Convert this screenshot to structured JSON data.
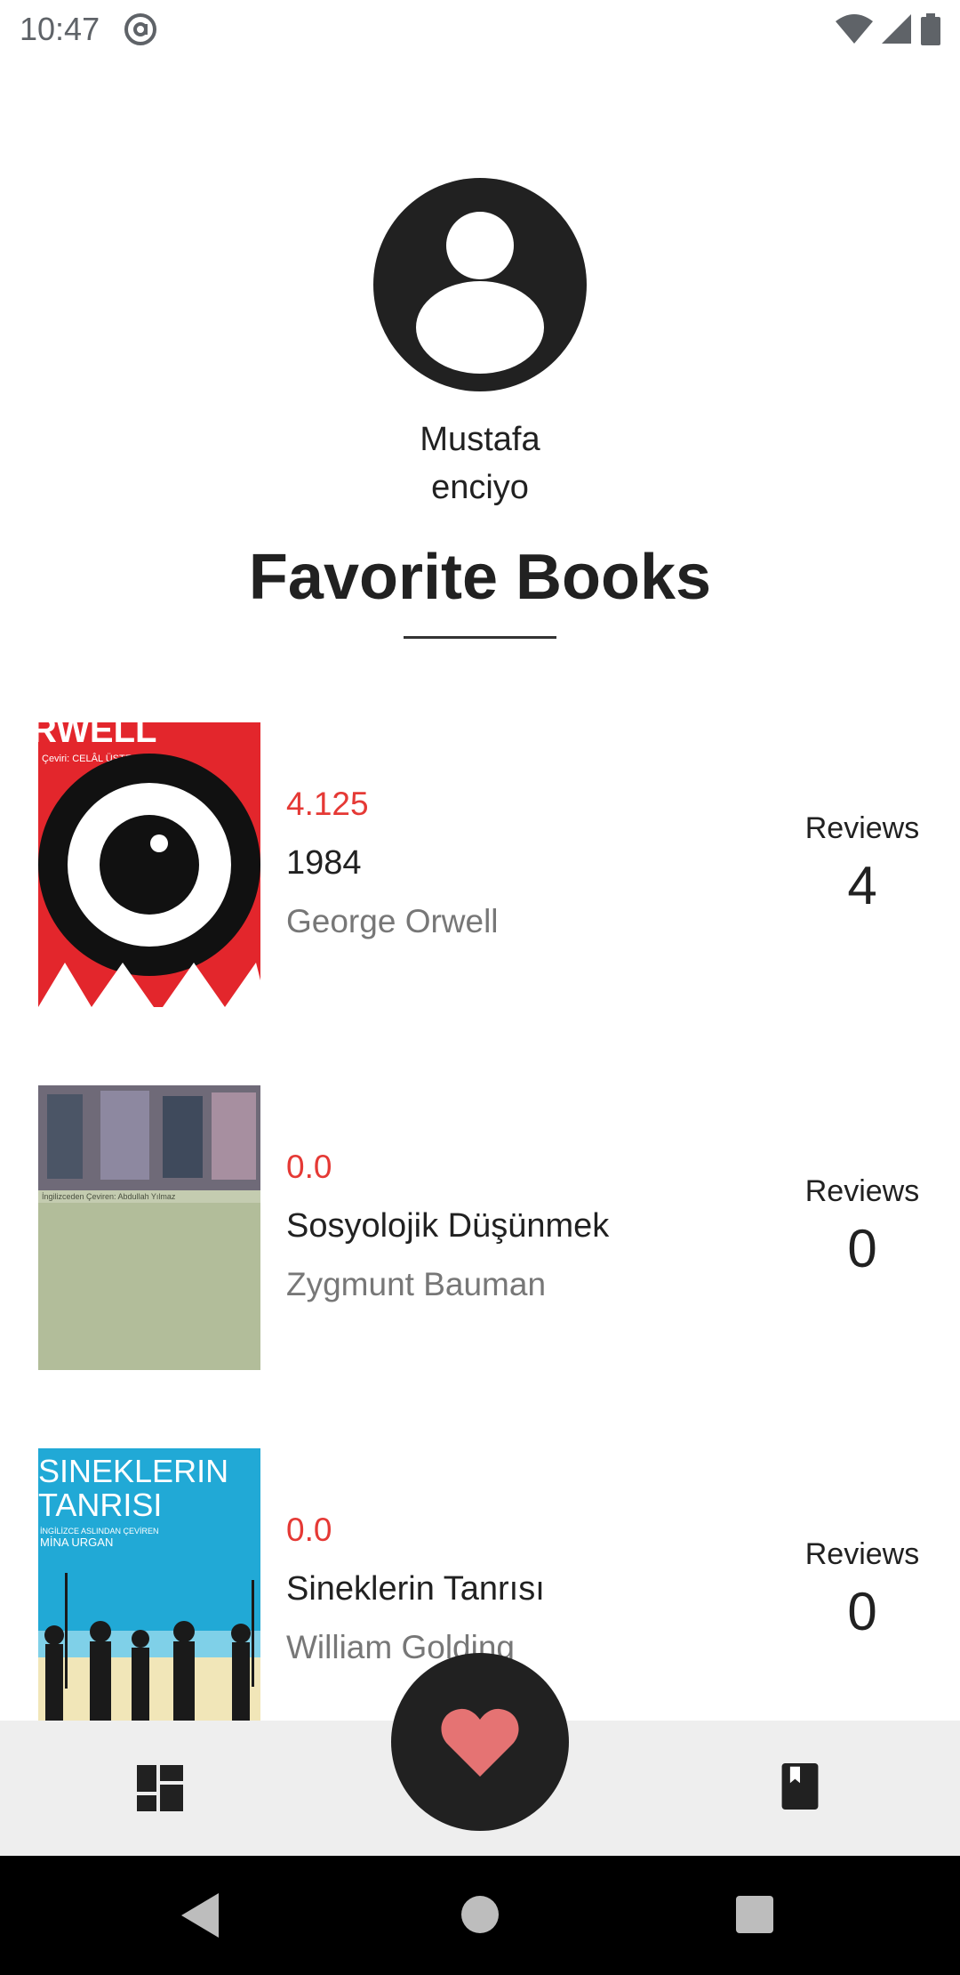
{
  "status_bar": {
    "time": "10:47"
  },
  "profile": {
    "name": "Mustafa\nenciyo"
  },
  "section": {
    "title": "Favorite Books"
  },
  "books": [
    {
      "rating": "4.125",
      "title": "1984",
      "author": "George Orwell",
      "reviews_label": "Reviews",
      "reviews_count": "4",
      "cover_text": "RWELL",
      "cover_subtext": "Çeviri: CELÂL ÜSTER"
    },
    {
      "rating": "0.0",
      "title": "Sosyolojik Düşünmek",
      "author": "Zygmunt Bauman",
      "reviews_label": "Reviews",
      "reviews_count": "0",
      "cover_subtext": "İngilizceden Çeviren: Abdullah Yılmaz"
    },
    {
      "rating": "0.0",
      "title": "Sineklerin Tanrısı",
      "author": "William Golding",
      "reviews_label": "Reviews",
      "reviews_count": "0",
      "cover_text_1": "SINEKLERIN",
      "cover_text_2": "TANRISI",
      "cover_subtext": "İNGİLİZCE ASLINDAN ÇEVİREN",
      "cover_translator": "MİNA URGAN"
    }
  ],
  "bottom_nav": {
    "left_icon": "dashboard-icon",
    "center_icon": "heart-icon",
    "right_icon": "book-icon"
  },
  "colors": {
    "rating": "#e53935",
    "fab": "#212121",
    "heart": "#e57373",
    "nav_bg": "#eeeeee"
  }
}
